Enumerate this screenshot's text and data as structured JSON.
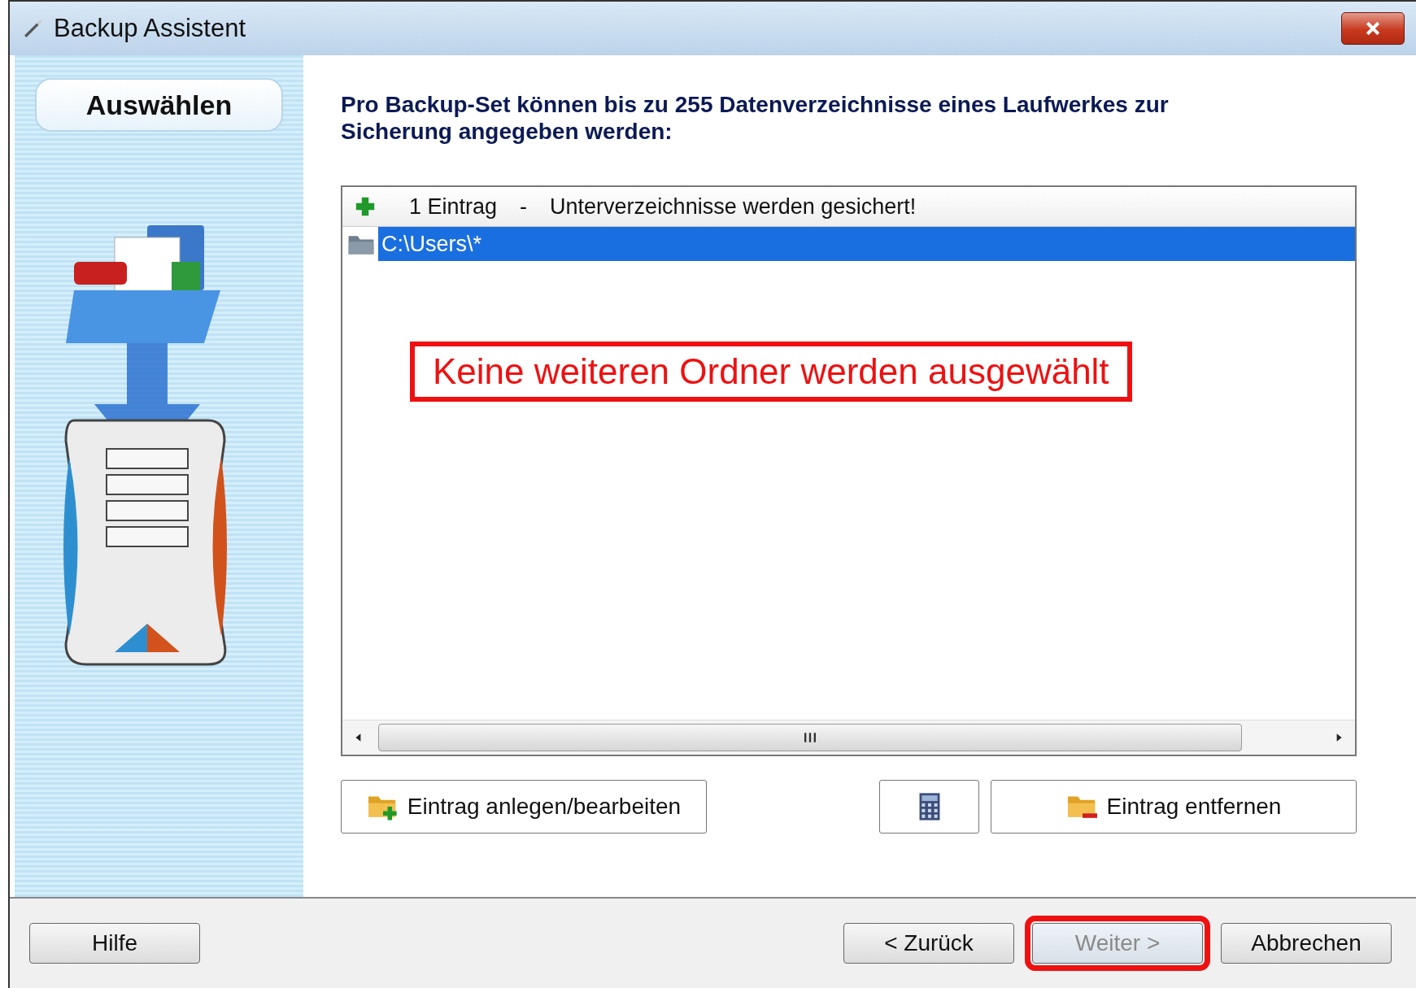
{
  "window": {
    "title": "Backup Assistent"
  },
  "sidebar": {
    "step": "Auswählen"
  },
  "instruction": "Pro Backup-Set können bis zu 255 Datenverzeichnisse eines Laufwerkes zur Sicherung angegeben werden:",
  "list": {
    "count": "1 Eintrag",
    "separator": "-",
    "note": "Unterverzeichnisse werden gesichert!",
    "items": [
      {
        "path": "C:\\Users\\*",
        "selected": true
      }
    ],
    "annotation": "Keine weiteren Ordner werden ausgewählt"
  },
  "actions": [
    {
      "kind": "add",
      "label": "Eintrag anlegen/bearbeiten"
    },
    {
      "kind": "calc"
    },
    {
      "kind": "remove",
      "label": "Eintrag entfernen"
    }
  ],
  "footer": [
    {
      "label": "Hilfe",
      "disabled": false,
      "highlighted": false
    },
    {
      "label": "< Zurück",
      "disabled": false,
      "highlighted": false
    },
    {
      "label": "Weiter >",
      "disabled": true,
      "highlighted": true
    },
    {
      "label": "Abbrechen",
      "disabled": false,
      "highlighted": false
    }
  ]
}
